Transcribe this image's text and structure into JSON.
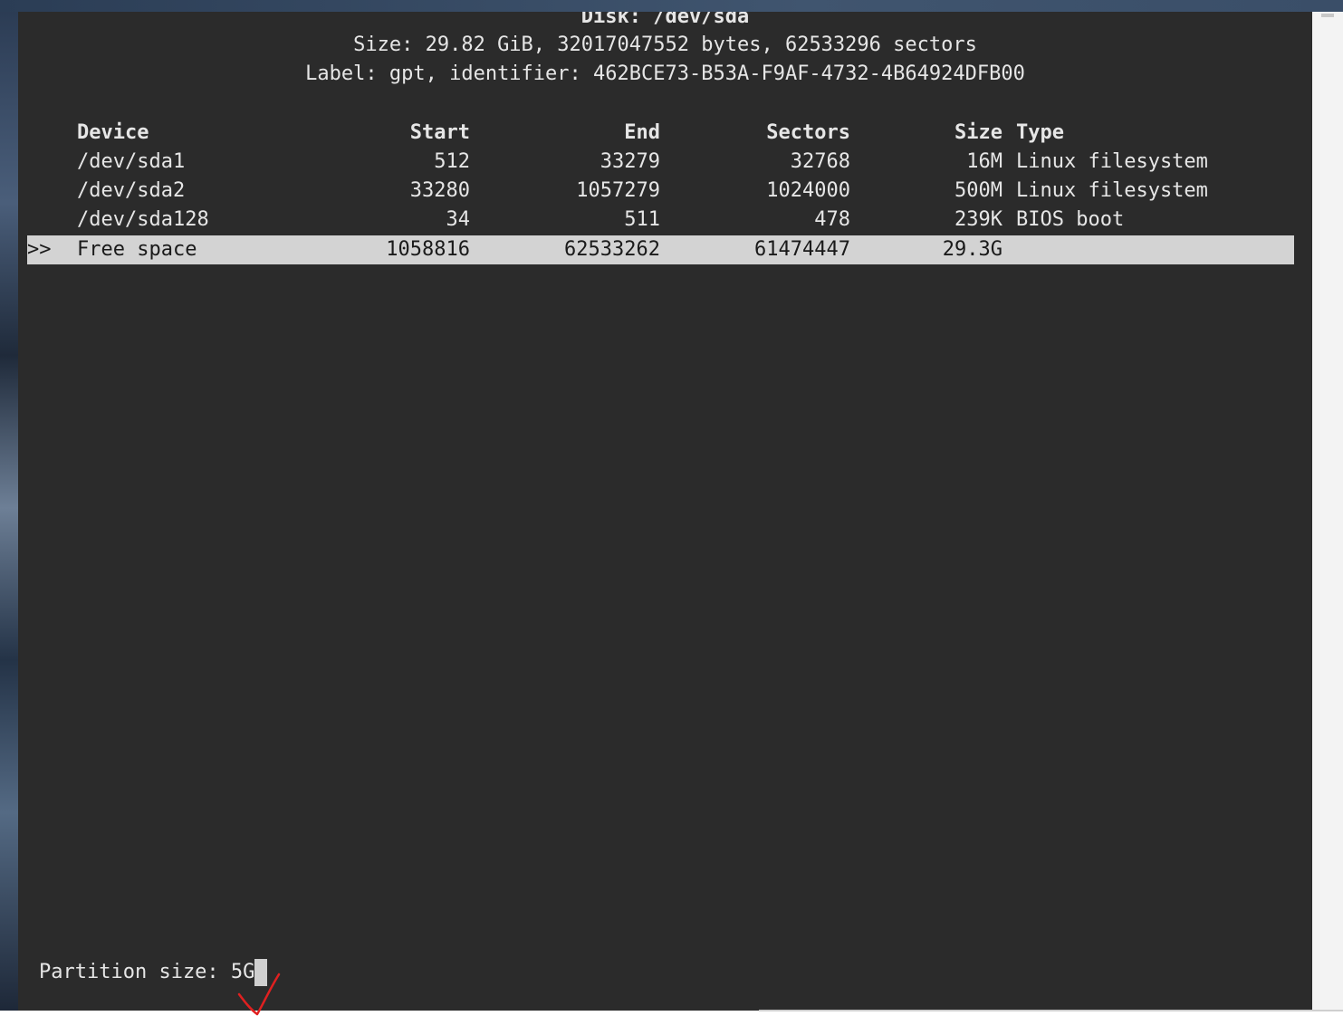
{
  "disk": {
    "title": "Disk: /dev/sda",
    "size_line": "Size: 29.82 GiB, 32017047552 bytes, 62533296 sectors",
    "label_line": "Label: gpt, identifier: 462BCE73-B53A-F9AF-4732-4B64924DFB00"
  },
  "table": {
    "headers": {
      "device": "Device",
      "start": "Start",
      "end": "End",
      "sectors": "Sectors",
      "size": "Size",
      "type": "Type"
    },
    "rows": [
      {
        "marker": "",
        "device": "/dev/sda1",
        "start": "512",
        "end": "33279",
        "sectors": "32768",
        "size": "16M",
        "type": "Linux filesystem"
      },
      {
        "marker": "",
        "device": "/dev/sda2",
        "start": "33280",
        "end": "1057279",
        "sectors": "1024000",
        "size": "500M",
        "type": "Linux filesystem"
      },
      {
        "marker": "",
        "device": "/dev/sda128",
        "start": "34",
        "end": "511",
        "sectors": "478",
        "size": "239K",
        "type": "BIOS boot"
      },
      {
        "marker": ">>",
        "device": "Free space",
        "start": "1058816",
        "end": "62533262",
        "sectors": "61474447",
        "size": "29.3G",
        "type": ""
      }
    ],
    "selected_index": 3
  },
  "prompt": {
    "label": "Partition size: ",
    "value": "5G"
  },
  "colors": {
    "terminal_bg": "#2b2b2b",
    "text": "#e6e6e6",
    "selected_bg": "#d3d3d3",
    "annotation": "#e02020"
  },
  "icons": {
    "annotation": "red-checkmark-icon"
  }
}
